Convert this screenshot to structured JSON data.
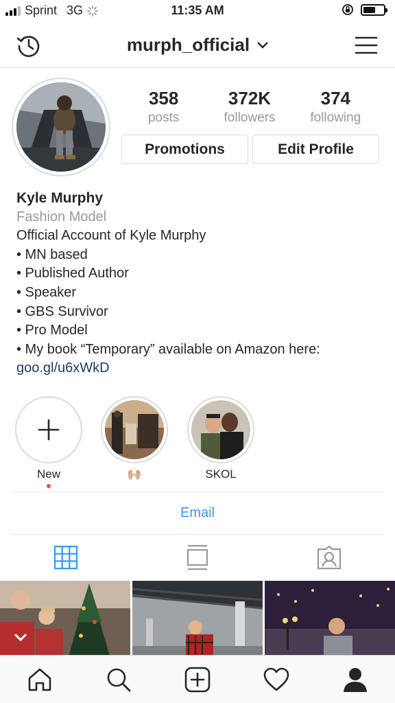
{
  "status_bar": {
    "carrier": "Sprint",
    "network": "3G",
    "time": "11:35 AM"
  },
  "header": {
    "username": "murph_official",
    "icons": {
      "left": "history-icon",
      "right": "menu-icon",
      "dropdown": "chevron-down-icon"
    }
  },
  "profile": {
    "stats": [
      {
        "value": "358",
        "label": "posts"
      },
      {
        "value": "372K",
        "label": "followers"
      },
      {
        "value": "374",
        "label": "following"
      }
    ],
    "buttons": {
      "promotions": "Promotions",
      "edit_profile": "Edit Profile"
    }
  },
  "bio": {
    "name": "Kyle Murphy",
    "category": "Fashion Model",
    "lines": [
      "Official Account of Kyle Murphy",
      "• MN based",
      "• Published Author",
      "• Speaker",
      "• GBS Survivor",
      "• Pro Model",
      "• My book “Temporary” available on Amazon here:"
    ],
    "link": "goo.gl/u6xWkD"
  },
  "highlights": [
    {
      "label": "New",
      "icon": "plus-icon"
    },
    {
      "label": "🙌🏼"
    },
    {
      "label": "SKOL"
    }
  ],
  "contact": {
    "email": "Email"
  },
  "tabs": [
    {
      "icon": "grid-icon",
      "active": true
    },
    {
      "icon": "feed-icon",
      "active": false
    },
    {
      "icon": "tagged-icon",
      "active": false
    }
  ],
  "bottom_nav": [
    {
      "icon": "home-icon"
    },
    {
      "icon": "search-icon"
    },
    {
      "icon": "add-post-icon"
    },
    {
      "icon": "heart-icon"
    },
    {
      "icon": "profile-icon",
      "active": true
    }
  ],
  "colors": {
    "accent": "#3897f0",
    "link": "#1d3b6b",
    "notification_dot": "#ed4956",
    "muted_text": "#999999",
    "border": "#dbdbdb"
  }
}
